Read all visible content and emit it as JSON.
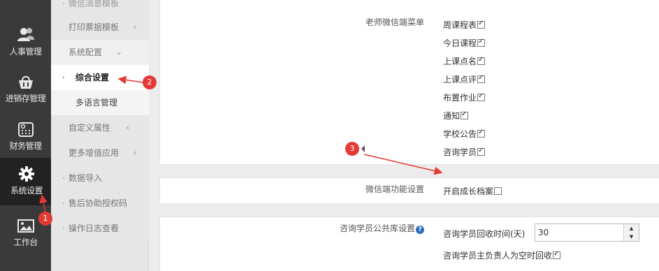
{
  "rail": {
    "items": [
      {
        "label": "人事管理",
        "icon": "users-icon"
      },
      {
        "label": "进销存管理",
        "icon": "basket-icon"
      },
      {
        "label": "财务管理",
        "icon": "finance-icon"
      },
      {
        "label": "系统设置",
        "icon": "gear-icon",
        "active": true
      },
      {
        "label": "工作台",
        "icon": "image-icon"
      }
    ]
  },
  "submenu": {
    "top_partial": "微信消息模板",
    "print_template": "打印票据模板",
    "system_config": "系统配置",
    "general_settings": "综合设置",
    "multilang": "多语言管理",
    "custom_attr": "自定义属性",
    "more_apps": "更多增值应用",
    "data_import": "数据导入",
    "after_sales": "售后协助授权码",
    "op_log": "操作日志查看"
  },
  "main": {
    "teacher_menu": {
      "label": "老师微信端菜单",
      "options": [
        {
          "label": "周课程表",
          "checked": true
        },
        {
          "label": "今日课程",
          "checked": true
        },
        {
          "label": "上课点名",
          "checked": true
        },
        {
          "label": "上课点评",
          "checked": true
        },
        {
          "label": "布置作业",
          "checked": true
        },
        {
          "label": "通知",
          "checked": true
        },
        {
          "label": "学校公告",
          "checked": true
        },
        {
          "label": "咨询学员",
          "checked": true
        }
      ]
    },
    "wechat_features": {
      "label": "微信端功能设置",
      "option": "开启成长档案",
      "checked": false
    },
    "public_pool": {
      "label": "咨询学员公共库设置",
      "recycle_label": "咨询学员回收时间(天)",
      "recycle_value": "30",
      "empty_owner_label": "咨询学员主负责人为空时回收",
      "empty_owner_checked": true
    }
  },
  "annotations": {
    "badge1": "1",
    "badge2": "2",
    "badge3": "3",
    "color": "#e23b36"
  }
}
